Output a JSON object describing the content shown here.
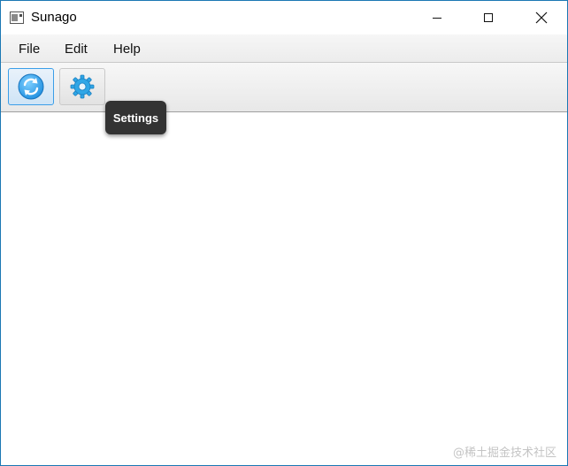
{
  "window": {
    "title": "Sunago",
    "controls": [
      "minimize",
      "maximize",
      "close"
    ]
  },
  "menubar": {
    "items": [
      {
        "label": "File"
      },
      {
        "label": "Edit"
      },
      {
        "label": "Help"
      }
    ]
  },
  "toolbar": {
    "buttons": [
      {
        "icon": "refresh-icon",
        "state": "pressed"
      },
      {
        "icon": "gear-icon",
        "state": "hover"
      }
    ]
  },
  "tooltip": {
    "text": "Settings"
  },
  "watermark": {
    "text": "@稀土掘金技术社区"
  },
  "colors": {
    "accent": "#3b9ee8",
    "window_border": "#1b78b4",
    "tooltip_bg": "#333333"
  }
}
